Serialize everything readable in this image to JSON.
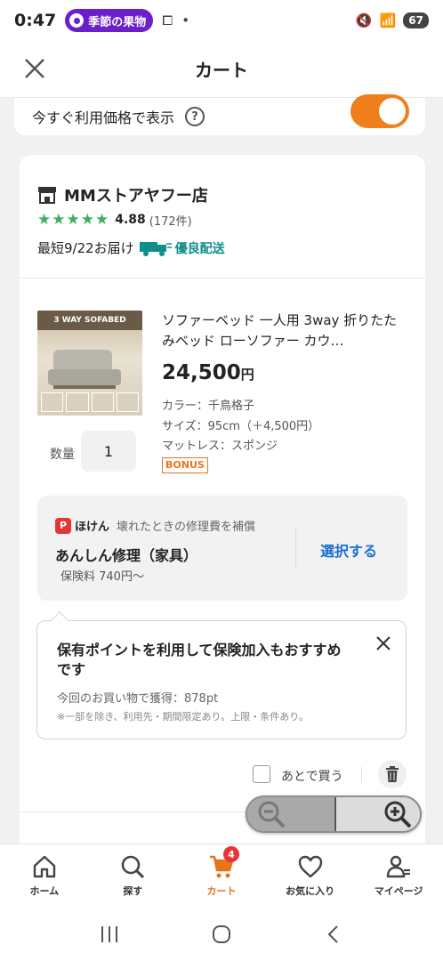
{
  "status_bar": {
    "time": "0:47",
    "notification": "季節の果物",
    "battery": "67"
  },
  "header": {
    "title": "カート"
  },
  "price_toggle": {
    "label": "今すぐ利用価格で表示",
    "on": true,
    "color": "#f07f1b"
  },
  "store": {
    "name": "MMストアヤフー店",
    "stars": "★★★★★",
    "rating": "4.88",
    "review_count": "(172件)",
    "delivery": "最短9/22お届け",
    "delivery_badge": "優良配送"
  },
  "item": {
    "image_banner": "3 WAY SOFABED",
    "title": "ソファーベッド 一人用 3way 折りたたみベッド ローソファー カウ…",
    "price": "24,500",
    "currency": "円",
    "color": "カラー：千鳥格子",
    "size": "サイズ：95cm（＋4,500円）",
    "mattress": "マットレス：スポンジ",
    "bonus": "BONUS",
    "qty_label": "数量",
    "qty": "1"
  },
  "insurance": {
    "logo": "P",
    "brand": "ほけん",
    "desc": "壊れたときの修理費を補償",
    "title": "あんしん修理（家具）",
    "fee": "保険料 740円〜",
    "action": "選択する"
  },
  "tooltip": {
    "title": "保有ポイントを利用して保険加入もおすすめです",
    "line1": "今回のお買い物で獲得：878pt",
    "line2": "※一部を除き、利用先・期間限定あり。上限・条件あり。"
  },
  "later": {
    "label": "あとで買う"
  },
  "bottom_nav": [
    {
      "label": "ホーム",
      "icon": "home-icon"
    },
    {
      "label": "探す",
      "icon": "search-icon"
    },
    {
      "label": "カート",
      "icon": "cart-icon",
      "badge": "4",
      "active": true
    },
    {
      "label": "お気に入り",
      "icon": "heart-icon"
    },
    {
      "label": "マイページ",
      "icon": "user-icon"
    }
  ],
  "colors": {
    "accent": "#f07f1b",
    "link": "#1a6fd3",
    "rating": "#3fae61",
    "delivery": "#0e8f8a",
    "badge": "#e53535"
  }
}
